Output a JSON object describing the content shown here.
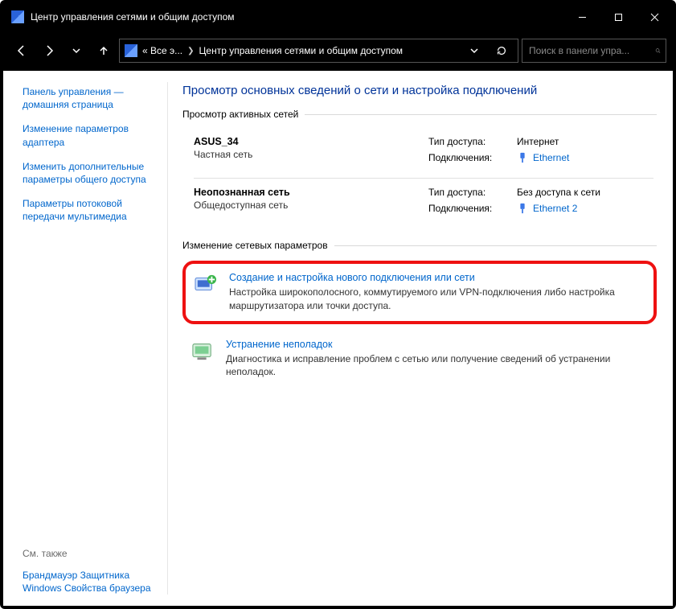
{
  "window": {
    "title": "Центр управления сетями и общим доступом"
  },
  "addressbar": {
    "crumb1": "« Все э...",
    "crumb2": "Центр управления сетями и общим доступом"
  },
  "search": {
    "placeholder": "Поиск в панели упра..."
  },
  "sidebar": {
    "home": "Панель управления — домашняя страница",
    "links": [
      "Изменение параметров адаптера",
      "Изменить дополнительные параметры общего доступа",
      "Параметры потоковой передачи мультимедиа"
    ],
    "see_also_label": "См. также",
    "footer_links": [
      "Брандмауэр Защитника Windows",
      "Свойства браузера"
    ]
  },
  "main": {
    "heading": "Просмотр основных сведений о сети и настройка подключений",
    "active_networks_legend": "Просмотр активных сетей",
    "labels": {
      "access": "Тип доступа:",
      "conn": "Подключения:"
    },
    "networks": [
      {
        "name": "ASUS_34",
        "type": "Частная сеть",
        "access_value": "Интернет",
        "conn_link": "Ethernet"
      },
      {
        "name": "Неопознанная сеть",
        "type": "Общедоступная сеть",
        "access_value": "Без доступа к сети",
        "conn_link": "Ethernet 2"
      }
    ],
    "change_settings_legend": "Изменение сетевых параметров",
    "actions": [
      {
        "title": "Создание и настройка нового подключения или сети",
        "desc": "Настройка широкополосного, коммутируемого или VPN-подключения либо настройка маршрутизатора или точки доступа."
      },
      {
        "title": "Устранение неполадок",
        "desc": "Диагностика и исправление проблем с сетью или получение сведений об устранении неполадок."
      }
    ]
  }
}
